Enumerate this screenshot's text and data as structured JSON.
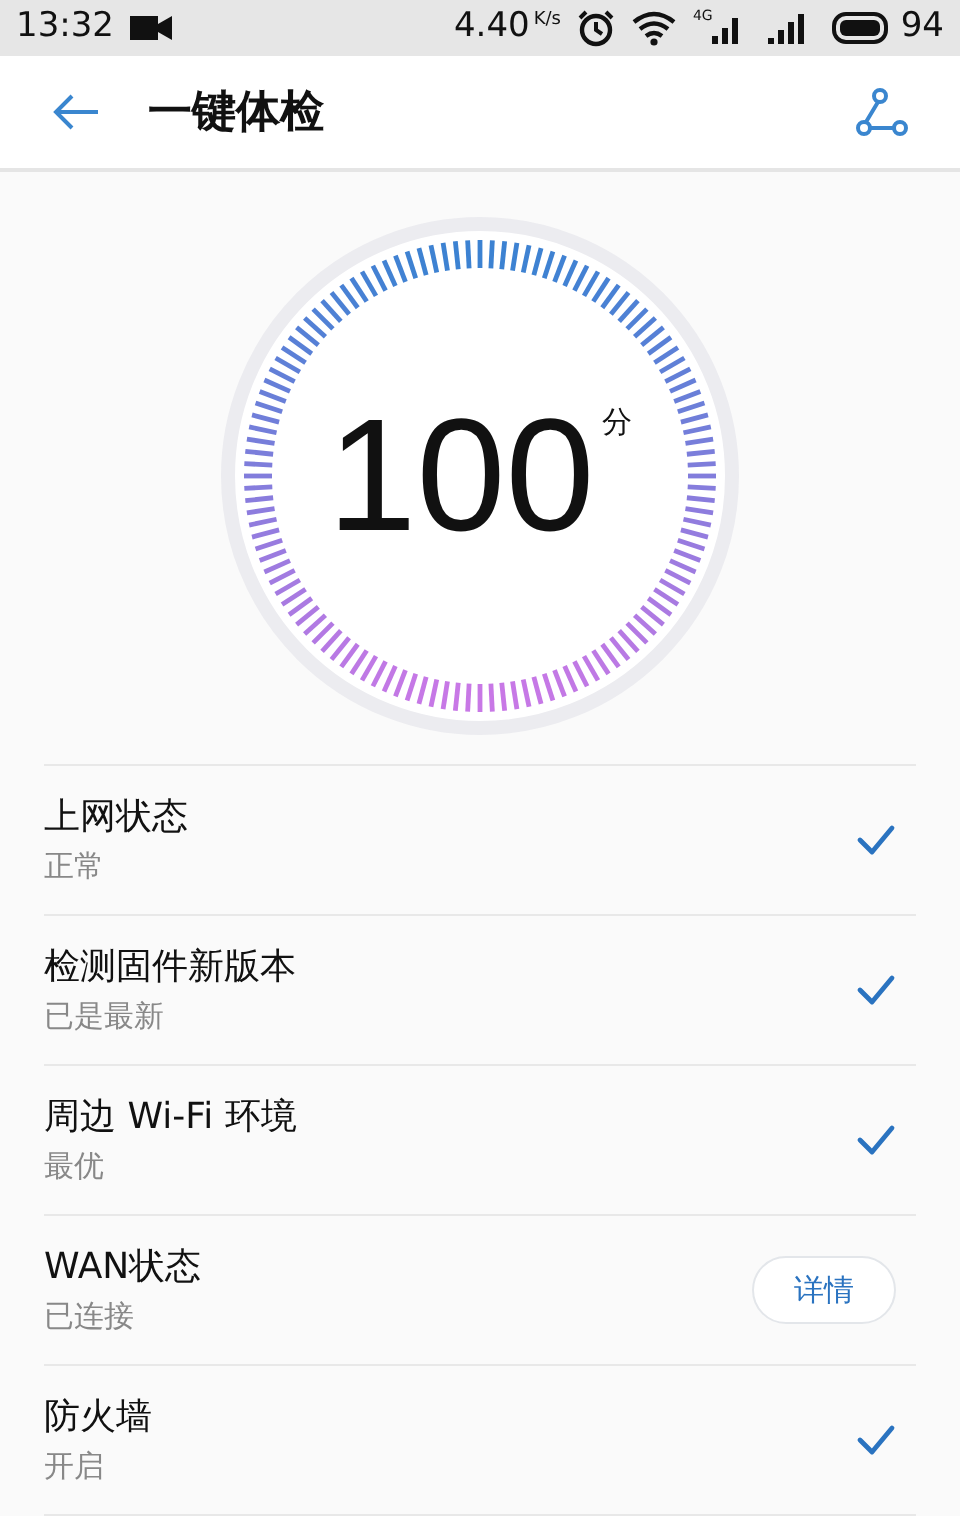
{
  "status_bar": {
    "time": "13:32",
    "speed": "4.40",
    "speed_unit": "K/s",
    "network_type": "4G",
    "battery": "94"
  },
  "header": {
    "title": "一键体检"
  },
  "score": {
    "value": "100",
    "unit": "分"
  },
  "items": [
    {
      "title": "上网状态",
      "status": "正常",
      "kind": "check"
    },
    {
      "title": "检测固件新版本",
      "status": "已是最新",
      "kind": "check"
    },
    {
      "title": "周边 Wi-Fi 环境",
      "status": "最优",
      "kind": "check"
    },
    {
      "title": "WAN状态",
      "status": "已连接",
      "kind": "button",
      "button_label": "详情"
    },
    {
      "title": "防火墙",
      "status": "开启",
      "kind": "check"
    }
  ]
}
